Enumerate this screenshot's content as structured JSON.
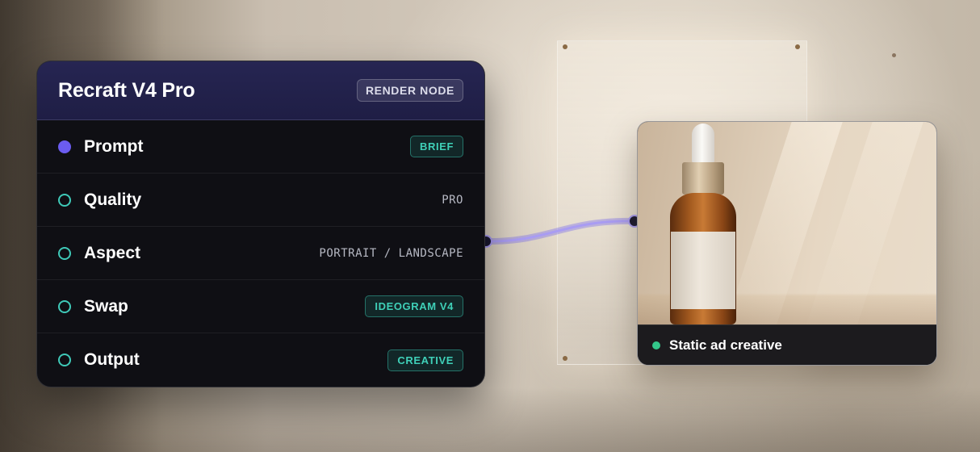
{
  "node": {
    "title": "Recraft V4 Pro",
    "badge": "RENDER NODE",
    "rows": [
      {
        "label": "Prompt",
        "value": "BRIEF",
        "value_style": "chip",
        "port": "filled"
      },
      {
        "label": "Quality",
        "value": "PRO",
        "value_style": "plain",
        "port": "hollow"
      },
      {
        "label": "Aspect",
        "value": "PORTRAIT / LANDSCAPE",
        "value_style": "plain",
        "port": "hollow"
      },
      {
        "label": "Swap",
        "value": "IDEOGRAM V4",
        "value_style": "chip",
        "port": "hollow"
      },
      {
        "label": "Output",
        "value": "CREATIVE",
        "value_style": "chip",
        "port": "hollow"
      }
    ]
  },
  "output": {
    "caption": "Static ad creative",
    "status_color": "#33c78a"
  },
  "colors": {
    "header_bg": "#262552",
    "card_bg": "#0f0f14",
    "accent_purple": "#6b5cf0",
    "accent_teal": "#3fd0b8",
    "wire": "#9b8cf0"
  }
}
